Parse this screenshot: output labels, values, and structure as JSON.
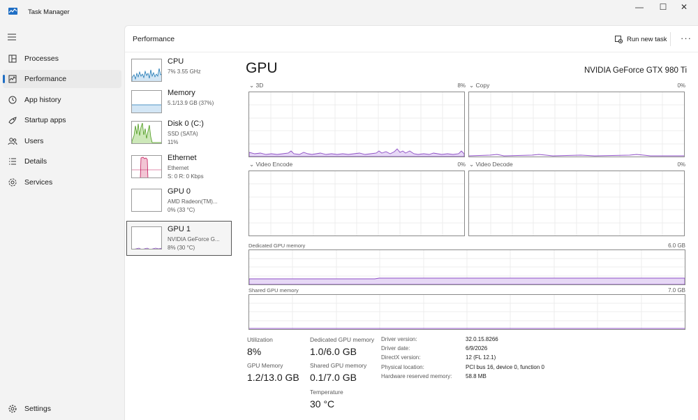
{
  "window": {
    "title": "Task Manager",
    "controls": {
      "minimize": "—",
      "maximize": "☐",
      "close": "✕"
    }
  },
  "sidebar": {
    "items": [
      {
        "label": "Processes",
        "icon": "processes-icon"
      },
      {
        "label": "Performance",
        "icon": "performance-icon",
        "active": true
      },
      {
        "label": "App history",
        "icon": "history-icon"
      },
      {
        "label": "Startup apps",
        "icon": "startup-icon"
      },
      {
        "label": "Users",
        "icon": "users-icon"
      },
      {
        "label": "Details",
        "icon": "details-icon"
      },
      {
        "label": "Services",
        "icon": "services-icon"
      }
    ],
    "settings": "Settings"
  },
  "header": {
    "title": "Performance",
    "run_new_task": "Run new task",
    "more": "···"
  },
  "devices": [
    {
      "name": "CPU",
      "lines": [
        "7% 3.55 GHz"
      ]
    },
    {
      "name": "Memory",
      "lines": [
        "5.1/13.9 GB (37%)"
      ]
    },
    {
      "name": "Disk 0 (C:)",
      "lines": [
        "SSD (SATA)",
        "11%"
      ]
    },
    {
      "name": "Ethernet",
      "lines": [
        "Ethernet",
        "S: 0 R: 0 Kbps"
      ]
    },
    {
      "name": "GPU 0",
      "lines": [
        "AMD Radeon(TM)...",
        "0% (33 °C)"
      ]
    },
    {
      "name": "GPU 1",
      "lines": [
        "NVIDIA GeForce G...",
        "8% (30 °C)"
      ],
      "selected": true
    }
  ],
  "gpu": {
    "title": "GPU",
    "model": "NVIDIA GeForce GTX 980 Ti",
    "engines": [
      {
        "label": "3D",
        "value": "8%"
      },
      {
        "label": "Copy",
        "value": "0%"
      },
      {
        "label": "Video Encode",
        "value": "0%"
      },
      {
        "label": "Video Decode",
        "value": "0%"
      }
    ],
    "dedicated_memory": {
      "label": "Dedicated GPU memory",
      "max": "6.0 GB"
    },
    "shared_memory": {
      "label": "Shared GPU memory",
      "max": "7.0 GB"
    },
    "stats": {
      "utilization_label": "Utilization",
      "utilization": "8%",
      "dedicated_label": "Dedicated GPU memory",
      "dedicated": "1.0/6.0 GB",
      "gpu_memory_label": "GPU Memory",
      "gpu_memory": "1.2/13.0 GB",
      "shared_label": "Shared GPU memory",
      "shared": "0.1/7.0 GB",
      "temperature_label": "Temperature",
      "temperature": "30 °C"
    },
    "info": [
      {
        "key": "Driver version:",
        "value": "32.0.15.8266"
      },
      {
        "key": "Driver date:",
        "value": "6/9/2026"
      },
      {
        "key": "DirectX version:",
        "value": "12 (FL 12.1)"
      },
      {
        "key": "Physical location:",
        "value": "PCI bus 16, device 0, function 0"
      },
      {
        "key": "Hardware reserved memory:",
        "value": "58.8 MB"
      }
    ]
  },
  "colors": {
    "accent": "#1f6ec4",
    "gpu_line": "#8e4fc6",
    "gpu_fill": "#e6d8f5",
    "cpu": "#1f78b4",
    "disk": "#4d9a1f",
    "ethernet": "#c2185b"
  }
}
